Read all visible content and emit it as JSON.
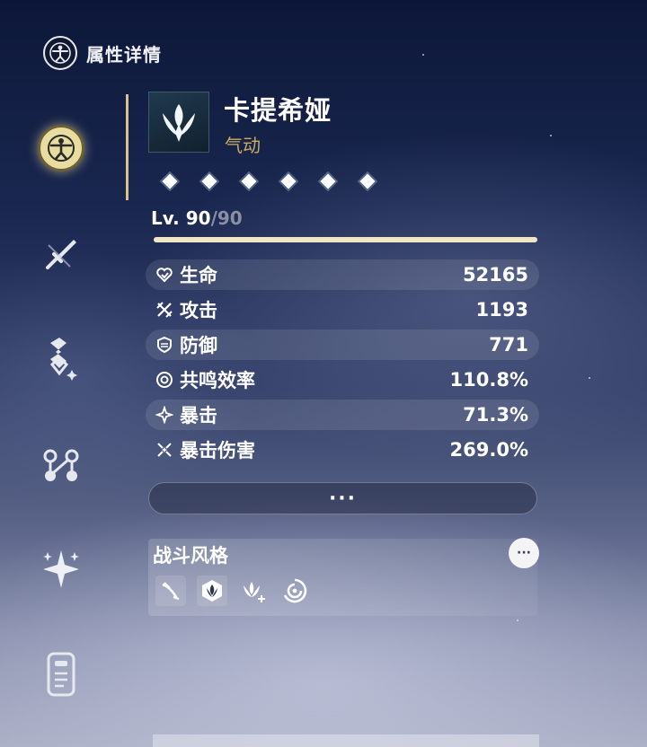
{
  "header": {
    "title": "属性详情",
    "icon": "vitruvian-icon"
  },
  "nav": {
    "items": [
      {
        "name": "attributes",
        "icon": "vitruvian-icon",
        "active": true
      },
      {
        "name": "weapon",
        "icon": "sword-icon",
        "active": false
      },
      {
        "name": "echo",
        "icon": "echo-icon",
        "active": false
      },
      {
        "name": "forte",
        "icon": "forte-icon",
        "active": false
      },
      {
        "name": "resonance-chain",
        "icon": "sparkle-icon",
        "active": false
      },
      {
        "name": "profile",
        "icon": "card-icon",
        "active": false
      }
    ]
  },
  "character": {
    "name": "卡提希娅",
    "element": "气动",
    "resonance_nodes": 6,
    "level": "90",
    "level_max": "90",
    "level_separator": "/",
    "level_prefix": "Lv. ",
    "exp_fill": 1.0
  },
  "stats": [
    {
      "icon": "heart-icon",
      "label": "生命",
      "value": "52165"
    },
    {
      "icon": "swords-icon",
      "label": "攻击",
      "value": "1193"
    },
    {
      "icon": "shield-icon",
      "label": "防御",
      "value": "771"
    },
    {
      "icon": "resonance-icon",
      "label": "共鸣效率",
      "value": "110.8%"
    },
    {
      "icon": "crit-icon",
      "label": "暴击",
      "value": "71.3%"
    },
    {
      "icon": "crit-damage-icon",
      "label": "暴击伤害",
      "value": "269.0%"
    }
  ],
  "more_button": {
    "label": "···"
  },
  "combat_style": {
    "title": "战斗风格",
    "more_label": "···",
    "tags": [
      "slash-tag-icon",
      "emblem-tag-icon",
      "wing-plus-tag-icon",
      "swirl-tag-icon"
    ]
  },
  "colors": {
    "accent_gold": "#e9dca0",
    "element_gold": "#c9ae5e",
    "level_fill": "#efe7c6"
  }
}
